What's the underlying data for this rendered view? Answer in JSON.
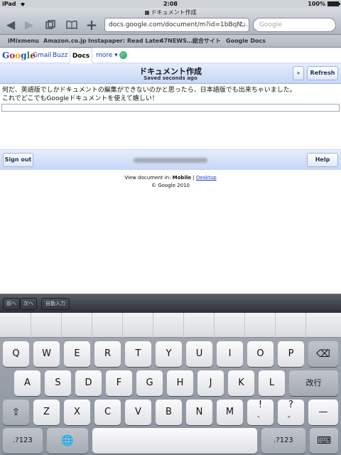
{
  "status_bar": {
    "carrier": "iPad",
    "time": "2:08",
    "battery": "100%"
  },
  "toolbar": {
    "page_title": "ドキュメント作成",
    "url": "docs.google.com/document/m?id=1bBqN…",
    "search_placeholder": "Google",
    "icons": [
      "back-icon",
      "forward-icon",
      "pages-icon",
      "bookmarks-icon",
      "add-icon",
      "reload-icon"
    ]
  },
  "bookmarks": [
    "iMixmenu",
    "Amazon.co.jp",
    "Instapaper: Read Later",
    "47NEWS…総合サイト",
    "Google Docs"
  ],
  "google_nav": {
    "logo": "Google",
    "links": [
      "Gmail",
      "Buzz"
    ],
    "active": "Docs",
    "more": "more ▾"
  },
  "doc": {
    "title": "ドキュメント作成",
    "status": "Saved seconds ago",
    "chevron": "»",
    "refresh": "Refresh",
    "body_line1": "何だ、英語版でしかドキュメントの編集ができないのかと思ったら、日本語版でも出来ちゃいました。",
    "body_line2": "これでどこでもGoogleドキュメントを使えて嬉しい！"
  },
  "footer": {
    "sign_out": "Sign out",
    "help": "Help",
    "view_prefix": "View document in: ",
    "view_mobile": "Mobile",
    "view_sep": " | ",
    "view_desktop": "Desktop",
    "copyright": "© Google 2010"
  },
  "form_assistant": {
    "prev": "前へ",
    "next": "次へ",
    "autofill": "自動入力"
  },
  "keyboard": {
    "row1": [
      "Q",
      "W",
      "E",
      "R",
      "T",
      "Y",
      "U",
      "I",
      "O",
      "P"
    ],
    "row2": [
      "A",
      "S",
      "D",
      "F",
      "G",
      "H",
      "J",
      "K",
      "L"
    ],
    "row3": [
      "Z",
      "X",
      "C",
      "V",
      "B",
      "N",
      "M"
    ],
    "return": "改行",
    "excl_top": "!",
    "excl_bottom": "、",
    "q_top": "?",
    "q_bottom": "。",
    "dash": "—",
    "numbers_left": ".?123",
    "numbers_right": ".?123",
    "backspace": "⌫",
    "shift": "⇧",
    "globe": "🌐",
    "hide": "⌨"
  }
}
